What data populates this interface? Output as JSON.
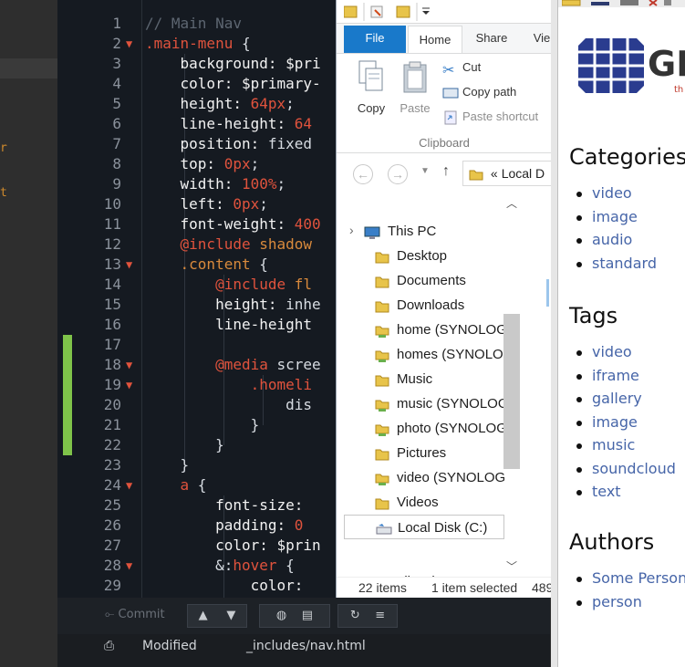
{
  "editor": {
    "lines": [
      {
        "n": "1",
        "fold": false,
        "html": "<span class='c-comment'>// Main Nav</span>"
      },
      {
        "n": "2",
        "fold": true,
        "html": "<span class='c-sel'>.main-menu</span> {"
      },
      {
        "n": "3",
        "fold": false,
        "html": "    <span class='c-prop'>background:</span> <span class='c-var'>$pri</span>"
      },
      {
        "n": "4",
        "fold": false,
        "html": "    <span class='c-prop'>color:</span> <span class='c-var'>$primary-</span>"
      },
      {
        "n": "5",
        "fold": false,
        "html": "    <span class='c-prop'>height:</span> <span class='c-num'>64px</span>;"
      },
      {
        "n": "6",
        "fold": false,
        "html": "    <span class='c-prop'>line-height:</span> <span class='c-num'>64</span>"
      },
      {
        "n": "7",
        "fold": false,
        "html": "    <span class='c-prop'>position:</span> fixed"
      },
      {
        "n": "8",
        "fold": false,
        "html": "    <span class='c-prop'>top:</span> <span class='c-num'>0px</span>;"
      },
      {
        "n": "9",
        "fold": false,
        "html": "    <span class='c-prop'>width:</span> <span class='c-num'>100%</span>;"
      },
      {
        "n": "10",
        "fold": false,
        "html": "    <span class='c-prop'>left:</span> <span class='c-num'>0px</span>;"
      },
      {
        "n": "11",
        "fold": false,
        "html": "    <span class='c-prop'>font-weight:</span> <span class='c-num'>400</span>"
      },
      {
        "n": "12",
        "fold": false,
        "html": "    <span class='c-at'>@include</span> <span class='c-kw'>shadow</span>"
      },
      {
        "n": "13",
        "fold": true,
        "html": "    <span class='c-kw'>.content</span> {"
      },
      {
        "n": "14",
        "fold": false,
        "html": "        <span class='c-at'>@include</span> <span class='c-kw'>fl</span>"
      },
      {
        "n": "15",
        "fold": false,
        "html": "        <span class='c-prop'>height:</span> inhe"
      },
      {
        "n": "16",
        "fold": false,
        "html": "        <span class='c-prop'>line-height</span>"
      },
      {
        "n": "17",
        "fold": false,
        "html": ""
      },
      {
        "n": "18",
        "fold": true,
        "html": "        <span class='c-at'>@media</span> scree"
      },
      {
        "n": "19",
        "fold": true,
        "html": "            <span class='c-pink'>.homeli</span>"
      },
      {
        "n": "20",
        "fold": false,
        "html": "                dis"
      },
      {
        "n": "21",
        "fold": false,
        "html": "            }"
      },
      {
        "n": "22",
        "fold": false,
        "html": "        }"
      },
      {
        "n": "23",
        "fold": false,
        "html": "    }"
      },
      {
        "n": "24",
        "fold": true,
        "html": "    <span class='c-sel'>a</span> {"
      },
      {
        "n": "25",
        "fold": false,
        "html": "        <span class='c-prop'>font-size:</span>"
      },
      {
        "n": "26",
        "fold": false,
        "html": "        <span class='c-prop'>padding:</span> <span class='c-num'>0</span>"
      },
      {
        "n": "27",
        "fold": false,
        "html": "        <span class='c-prop'>color:</span> <span class='c-var'>$prin</span>"
      },
      {
        "n": "28",
        "fold": true,
        "html": "        &amp;:<span class='c-pink'>hover</span> {"
      },
      {
        "n": "29",
        "fold": false,
        "html": "            <span class='c-prop'>color:</span>"
      }
    ]
  },
  "git": {
    "commit_label": "Commit",
    "status": "Modified",
    "file": "_includes/nav.html"
  },
  "explorer": {
    "tabs": {
      "file": "File",
      "home": "Home",
      "share": "Share",
      "view": "Vie"
    },
    "ribbon": {
      "copy": "Copy",
      "paste": "Paste",
      "cut": "Cut",
      "copy_path": "Copy path",
      "paste_shortcut": "Paste shortcut",
      "group": "Clipboard"
    },
    "address": "Local D",
    "address_chevron": "«",
    "nav": [
      "This PC",
      "Desktop",
      "Documents",
      "Downloads",
      "home (SYNOLOGY",
      "homes (SYNOLOG",
      "Music",
      "music (SYNOLOGY",
      "photo (SYNOLOGY",
      "Pictures",
      "video (SYNOLOGY",
      "Videos",
      "Local Disk (C:)",
      "Libraries"
    ],
    "status": {
      "items": "22 items",
      "selected": "1 item selected",
      "size": "489"
    }
  },
  "web": {
    "logo": "GP",
    "logo_sub": "th",
    "sections": [
      {
        "title": "Categories",
        "items": [
          "video",
          "image",
          "audio",
          "standard"
        ]
      },
      {
        "title": "Tags",
        "items": [
          "video",
          "iframe",
          "gallery",
          "image",
          "music",
          "soundcloud",
          "text"
        ]
      },
      {
        "title": "Authors",
        "items": [
          "Some Person",
          "person"
        ]
      }
    ]
  },
  "colors": {
    "editor_bg": "#151a21",
    "git_gutter_added": "#7fc34a",
    "explorer_accent": "#1979ca",
    "web_link": "#4665a8"
  }
}
